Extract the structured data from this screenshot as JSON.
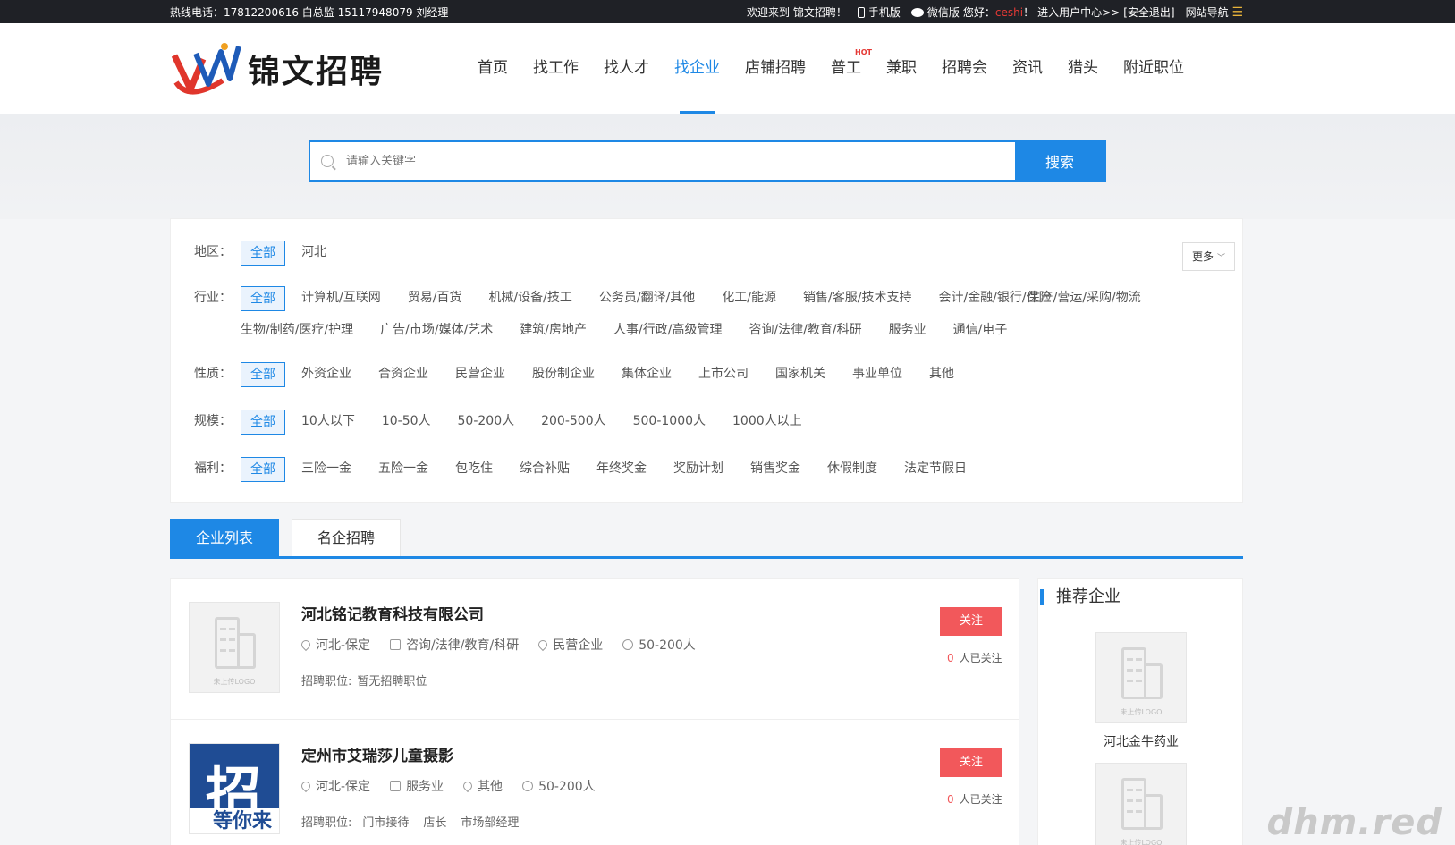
{
  "topbar": {
    "hotline": "热线电话：17812200616 白总监 15117948079 刘经理",
    "welcome": "欢迎来到 锦文招聘！",
    "mobile": "手机版",
    "wechat": "微信版",
    "greeting": "您好：",
    "username": "ceshi",
    "greeting_end": "！",
    "user_center": "进入用户中心>>",
    "logout": "[安全退出]",
    "site_nav": "网站导航"
  },
  "logo": {
    "text": "锦文招聘"
  },
  "nav": {
    "items": [
      "首页",
      "找工作",
      "找人才",
      "找企业",
      "店铺招聘",
      "普工",
      "兼职",
      "招聘会",
      "资讯",
      "猎头",
      "附近职位"
    ],
    "hot_badge": "HOT"
  },
  "search": {
    "placeholder": "请输入关键字",
    "button": "搜索"
  },
  "filters": {
    "more": "更多",
    "region": {
      "label": "地区：",
      "options": [
        "全部",
        "河北"
      ]
    },
    "industry": {
      "label": "行业：",
      "options": [
        "全部",
        "计算机/互联网",
        "贸易/百货",
        "机械/设备/技工",
        "公务员/翻译/其他",
        "化工/能源",
        "销售/客服/技术支持",
        "会计/金融/银行/保险",
        "生产/营运/采购/物流",
        "生物/制药/医疗/护理",
        "广告/市场/媒体/艺术",
        "建筑/房地产",
        "人事/行政/高级管理",
        "咨询/法律/教育/科研",
        "服务业",
        "通信/电子"
      ]
    },
    "nature": {
      "label": "性质：",
      "options": [
        "全部",
        "外资企业",
        "合资企业",
        "民营企业",
        "股份制企业",
        "集体企业",
        "上市公司",
        "国家机关",
        "事业单位",
        "其他"
      ]
    },
    "scale": {
      "label": "规模：",
      "options": [
        "全部",
        "10人以下",
        "10-50人",
        "50-200人",
        "200-500人",
        "500-1000人",
        "1000人以上"
      ]
    },
    "welfare": {
      "label": "福利：",
      "options": [
        "全部",
        "三险一金",
        "五险一金",
        "包吃住",
        "综合补贴",
        "年终奖金",
        "奖励计划",
        "销售奖金",
        "休假制度",
        "法定节假日"
      ]
    }
  },
  "tabs": [
    "企业列表",
    "名企招聘"
  ],
  "companies": [
    {
      "name": "河北铭记教育科技有限公司",
      "location": "河北-保定",
      "industry": "咨询/法律/教育/科研",
      "nature": "民营企业",
      "scale": "50-200人",
      "jobs_label": "招聘职位:",
      "jobs": [
        "暂无招聘职位"
      ],
      "follow": "关注",
      "followers": "0",
      "followers_label": "人已关注",
      "logo_caption": "未上传LOGO"
    },
    {
      "name": "定州市艾瑞莎儿童摄影",
      "location": "河北-保定",
      "industry": "服务业",
      "nature": "其他",
      "scale": "50-200人",
      "jobs_label": "招聘职位:",
      "jobs": [
        "门市接待",
        "店长",
        "市场部经理"
      ],
      "follow": "关注",
      "followers": "0",
      "followers_label": "人已关注",
      "logo_main": "招",
      "logo_sub": "等你来"
    }
  ],
  "recommended": {
    "title": "推荐企业",
    "items": [
      {
        "name": "河北金牛药业",
        "logo_caption": "未上传LOGO"
      },
      {
        "name": "",
        "logo_caption": "未上传LOGO"
      }
    ]
  },
  "watermark": "dhm.red",
  "colors": {
    "accent": "#1e88e5",
    "follow": "#f2585b",
    "topbar": "#1f2126"
  }
}
